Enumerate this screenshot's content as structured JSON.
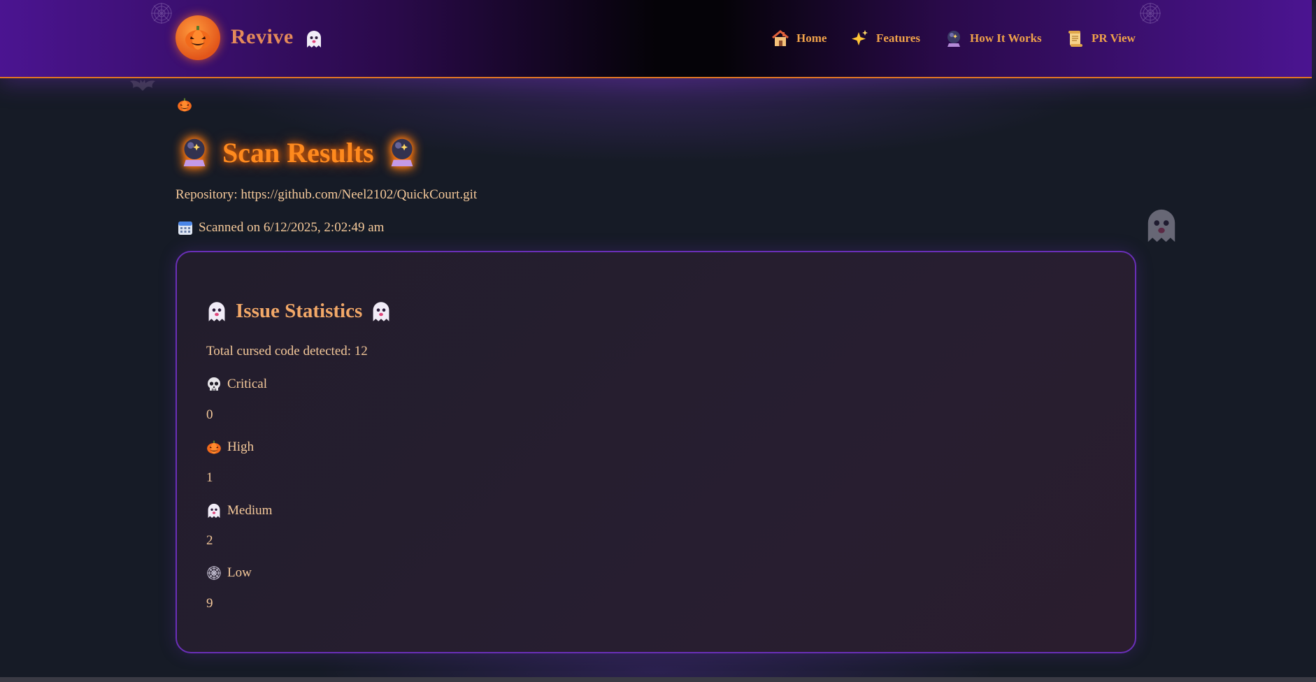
{
  "header": {
    "brand": "Revive",
    "logo_icon": "pumpkin-icon",
    "nav": [
      {
        "label": "Home",
        "icon": "house-icon"
      },
      {
        "label": "Features",
        "icon": "sparkles-icon"
      },
      {
        "label": "How It Works",
        "icon": "crystal-ball-icon"
      },
      {
        "label": "PR View",
        "icon": "scroll-icon"
      }
    ]
  },
  "main": {
    "title": "Scan Results",
    "repository": "Repository: https://github.com/Neel2102/QuickCourt.git",
    "scanned_on": "Scanned on 6/12/2025, 2:02:49 am"
  },
  "stats": {
    "title": "Issue Statistics",
    "total": "Total cursed code detected: 12",
    "severities": [
      {
        "label": "Critical",
        "value": "0",
        "icon": "skull-icon"
      },
      {
        "label": "High",
        "value": "1",
        "icon": "pumpkin-icon"
      },
      {
        "label": "Medium",
        "value": "2",
        "icon": "ghost-icon"
      },
      {
        "label": "Low",
        "value": "9",
        "icon": "spider-web-icon"
      }
    ]
  },
  "colors": {
    "accent_orange": "#ff8a1e",
    "purple_border": "#6a2fb8",
    "text": "#f5c99a"
  }
}
